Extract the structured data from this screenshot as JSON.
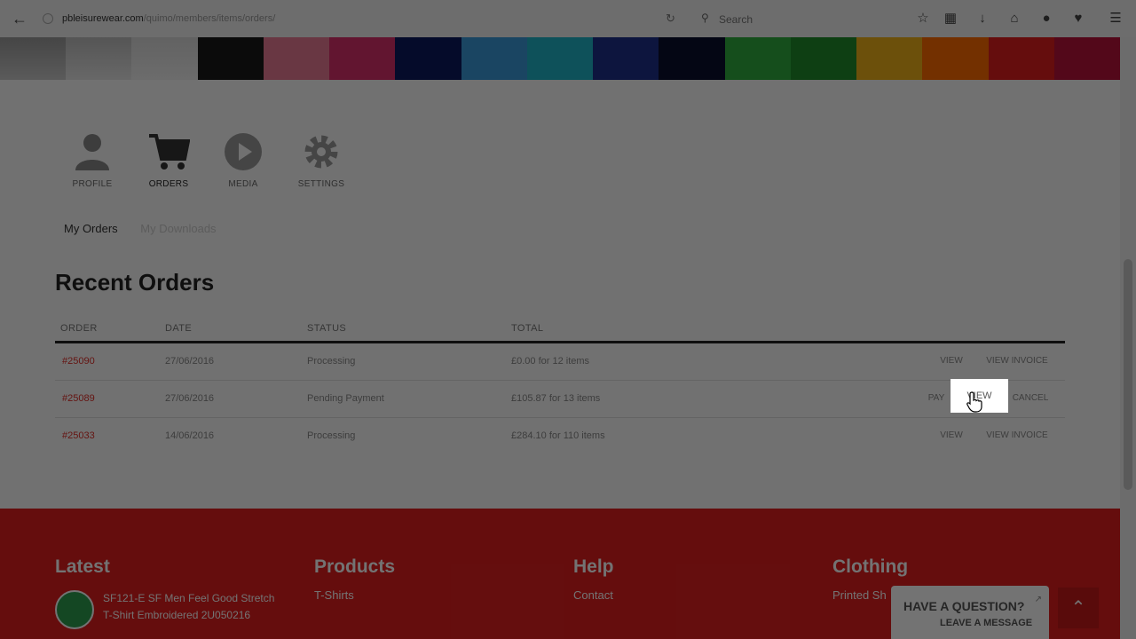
{
  "browser": {
    "url_domain": "pbleisurewear.com",
    "url_path": "/quimo/members/items/orders/",
    "search_placeholder": "Search"
  },
  "nav": {
    "items": [
      {
        "label": "PROFILE",
        "icon": "user-icon"
      },
      {
        "label": "ORDERS",
        "icon": "cart-icon"
      },
      {
        "label": "MEDIA",
        "icon": "play-icon"
      },
      {
        "label": "SETTINGS",
        "icon": "gear-icon"
      }
    ],
    "active": "ORDERS"
  },
  "subnav": {
    "tabs": [
      "My Orders",
      "My Downloads"
    ]
  },
  "orders": {
    "title": "Recent Orders",
    "columns": [
      "ORDER",
      "DATE",
      "STATUS",
      "TOTAL"
    ],
    "rows": [
      {
        "order": "#25090",
        "date": "27/06/2016",
        "status": "Processing",
        "total": "£0.00 for 12 items",
        "actions": [
          "VIEW",
          "VIEW INVOICE"
        ]
      },
      {
        "order": "#25089",
        "date": "27/06/2016",
        "status": "Pending Payment",
        "total": "£105.87 for 13 items",
        "actions": [
          "PAY",
          "VIEW",
          "CANCEL"
        ]
      },
      {
        "order": "#25033",
        "date": "14/06/2016",
        "status": "Processing",
        "total": "£284.10 for 110 items",
        "actions": [
          "VIEW",
          "VIEW INVOICE"
        ]
      }
    ]
  },
  "footer": {
    "latest": {
      "heading": "Latest",
      "item": "SF121-E SF Men Feel Good Stretch T-Shirt Embroidered 2U050216"
    },
    "products": {
      "heading": "Products",
      "link": "T-Shirts"
    },
    "help": {
      "heading": "Help",
      "link": "Contact"
    },
    "clothing": {
      "heading": "Clothing",
      "link": "Printed Sh"
    }
  },
  "chat": {
    "question": "HAVE A QUESTION?",
    "message": "LEAVE A MESSAGE"
  },
  "colors": {
    "accent": "#e01e1e",
    "order_link": "#e0302a"
  }
}
